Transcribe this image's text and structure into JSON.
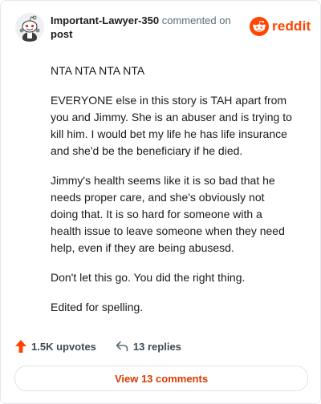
{
  "comment": {
    "author": "Important-Lawyer-350",
    "action": "commented on",
    "target": "post",
    "paragraphs": [
      "NTA NTA NTA NTA",
      "EVERYONE else in this story is TAH apart from you and Jimmy. She is an abuser and is trying to kill him. I would bet my life he has life insurance and she'd be the beneficiary if he died.",
      "Jimmy's health seems like it is so bad that he needs proper care, and she's obviously not doing that. It is so hard for someone with a health issue to leave someone when they need help, even if they are being abusesd.",
      "Don't let this go. You did the right thing.",
      "Edited for spelling."
    ]
  },
  "brand": {
    "wordmark": "reddit",
    "color": "#ff4500",
    "icon": "reddit-alien-icon"
  },
  "stats": {
    "upvotes": "1.5K upvotes",
    "replies": "13 replies",
    "upvote_color": "#ff4500"
  },
  "footer": {
    "view_button": "View 13 comments",
    "button_color": "#d93a00"
  }
}
